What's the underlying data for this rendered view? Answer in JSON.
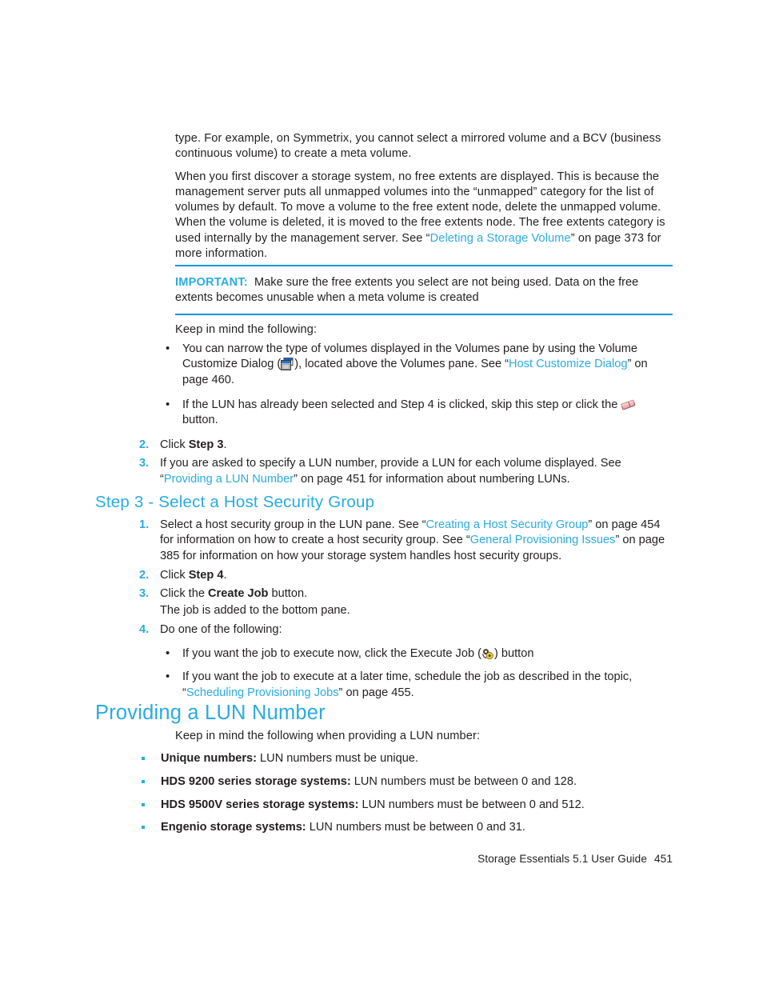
{
  "document": {
    "intro": {
      "para1_a": "type. For example, on Symmetrix, you cannot select a mirrored volume and a BCV (business continuous volume) to create a meta volume.",
      "para2_a": "When you first discover a storage system, no free extents are displayed. This is because the management server puts all unmapped volumes into the “unmapped” category for the list of volumes by default. To move a volume to the free extent node, delete the unmapped volume. When the volume is deleted, it is moved to the free extents node. The free extents category is used internally by the management server. See “",
      "para2_link": "Deleting a Storage Volume",
      "para2_b": "” on page 373 for more information."
    },
    "note": {
      "label": "IMPORTANT:",
      "text": "Make sure the free extents you select are not being used. Data on the free extents becomes unusable when a meta volume is created"
    },
    "keep_in_mind": {
      "lead": "Keep in mind the following:",
      "bullet1_a": "You can narrow the type of volumes displayed in the Volumes pane by using the Volume Customize Dialog (",
      "bullet1_icon": "customize-dialog-icon",
      "bullet1_b": "), located above the Volumes pane. See “",
      "bullet1_link": "Host Customize Dialog",
      "bullet1_c": "” on page 460.",
      "bullet2_a": "If the LUN has already been selected and Step 4 is clicked, skip this step or click the ",
      "bullet2_icon": "eraser-icon",
      "bullet2_b": " button."
    },
    "steps_upper": [
      {
        "num": "2.",
        "text_a": "Click ",
        "bold": "Step 3",
        "text_b": "."
      },
      {
        "num": "3.",
        "text_a": "If you are asked to specify a LUN number, provide a LUN for each volume displayed. See “",
        "link": "Providing a LUN Number",
        "text_b": "” on page 451 for information about numbering LUNs."
      }
    ],
    "section_step3": {
      "heading": "Step 3 - Select a Host Security Group",
      "items": [
        {
          "num": "1.",
          "text_a": "Select a host security group in the LUN pane. See “",
          "link1": "Creating a Host Security Group",
          "text_b": "” on page 454 for information on how to create a host security group. See “",
          "link2": "General Provisioning Issues",
          "text_c": "” on page 385 for information on how your storage system handles host security groups."
        },
        {
          "num": "2.",
          "text_a": "Click ",
          "bold": "Step 4",
          "text_b": "."
        },
        {
          "num": "3.",
          "text_a": "Click the ",
          "bold": "Create Job",
          "text_b": " button.",
          "sub": "The job is added to the bottom pane."
        },
        {
          "num": "4.",
          "text_a": "Do one of the following:"
        }
      ],
      "sub_bullets": {
        "bullet1_a": "If you want the job to execute now, click the Execute Job (",
        "bullet1_icon": "gears-icon",
        "bullet1_b": ") button",
        "bullet2_a": "If you want the job to execute at a later time, schedule the job as described in the topic, “",
        "bullet2_link": "Scheduling Provisioning Jobs",
        "bullet2_b": "” on page 455."
      }
    },
    "section_lun": {
      "heading": "Providing a LUN Number",
      "lead": "Keep in mind the following when providing a LUN number:",
      "bullets": [
        {
          "term": "Unique numbers:",
          "desc": " LUN numbers must be unique."
        },
        {
          "term": "HDS 9200 series storage systems:",
          "desc": " LUN numbers must be between 0 and 128."
        },
        {
          "term": "HDS 9500V series storage systems:",
          "desc": " LUN numbers must be between 0 and 512."
        },
        {
          "term": "Engenio storage systems:",
          "desc": " LUN numbers must be between 0 and 31."
        }
      ]
    },
    "footer": {
      "guide": "Storage Essentials 5.1 User Guide",
      "page": "451"
    },
    "colors": {
      "accent": "#29abe2",
      "rule": "#0f9bd7",
      "text": "#231f20"
    }
  }
}
